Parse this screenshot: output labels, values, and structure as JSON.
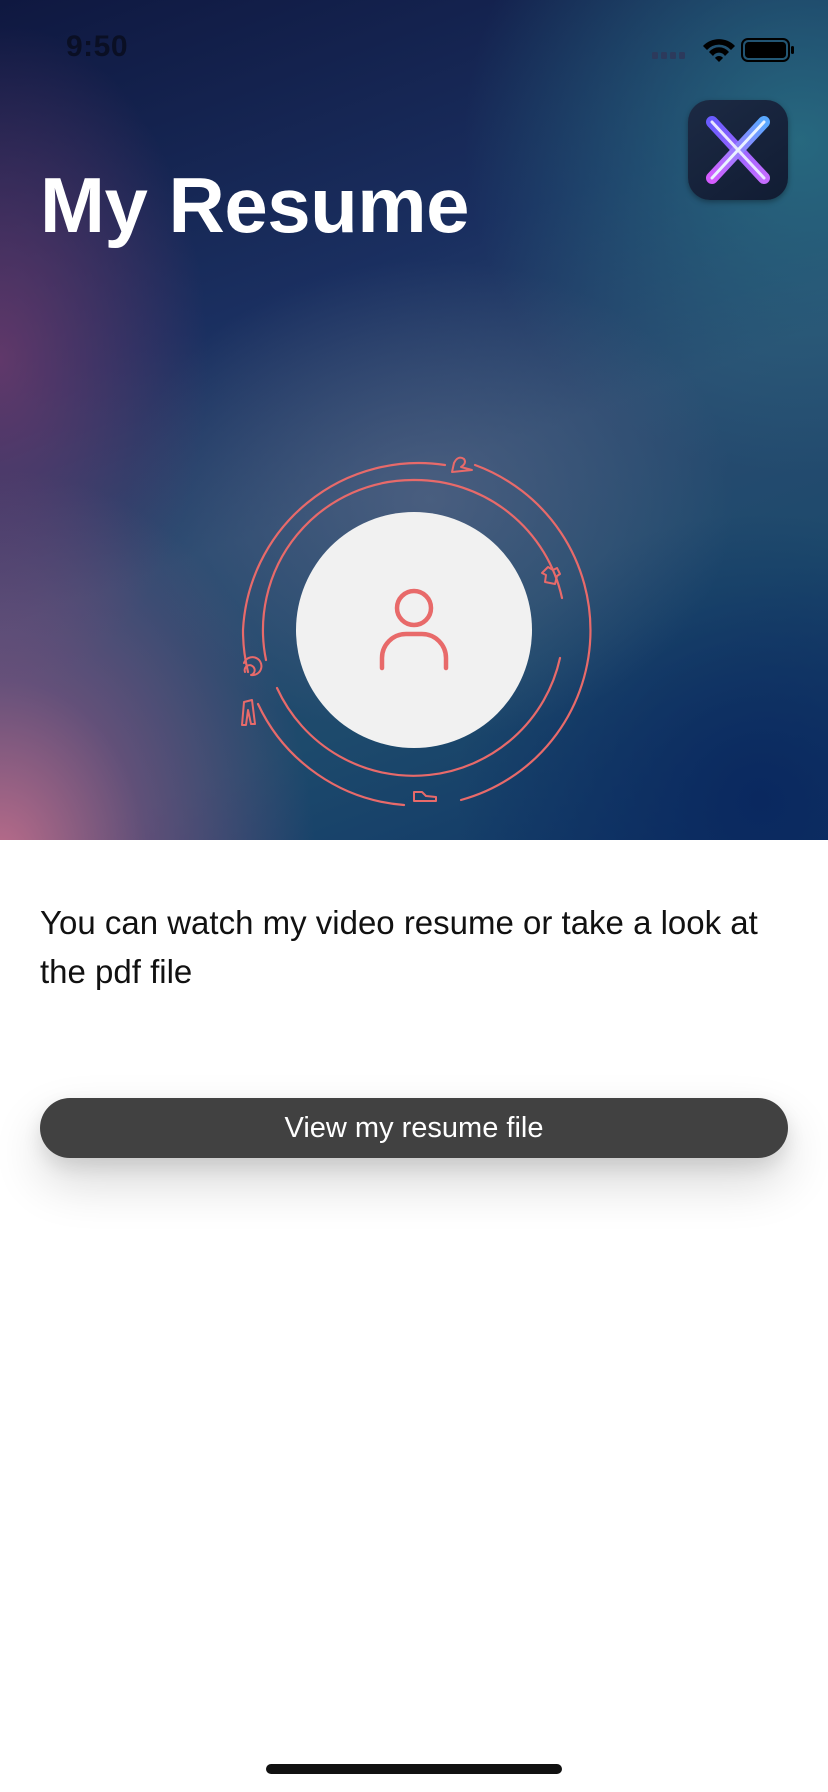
{
  "status_bar": {
    "time": "9:50",
    "icons": [
      "signal-icon",
      "wifi-icon",
      "battery-icon"
    ]
  },
  "header": {
    "title": "My Resume",
    "app_icon": "x-logo-icon"
  },
  "profile": {
    "avatar_icon": "user-icon",
    "ring_icons": [
      "hanger-icon",
      "shirt-icon",
      "swirl-icon",
      "pants-icon",
      "shoe-icon"
    ]
  },
  "content": {
    "description": "You can watch my video resume or take a look at the pdf file",
    "button_label": "View my resume file"
  },
  "colors": {
    "accent": "#e86a6a",
    "button_bg": "#414141",
    "avatar_bg": "#f1f1f1"
  }
}
